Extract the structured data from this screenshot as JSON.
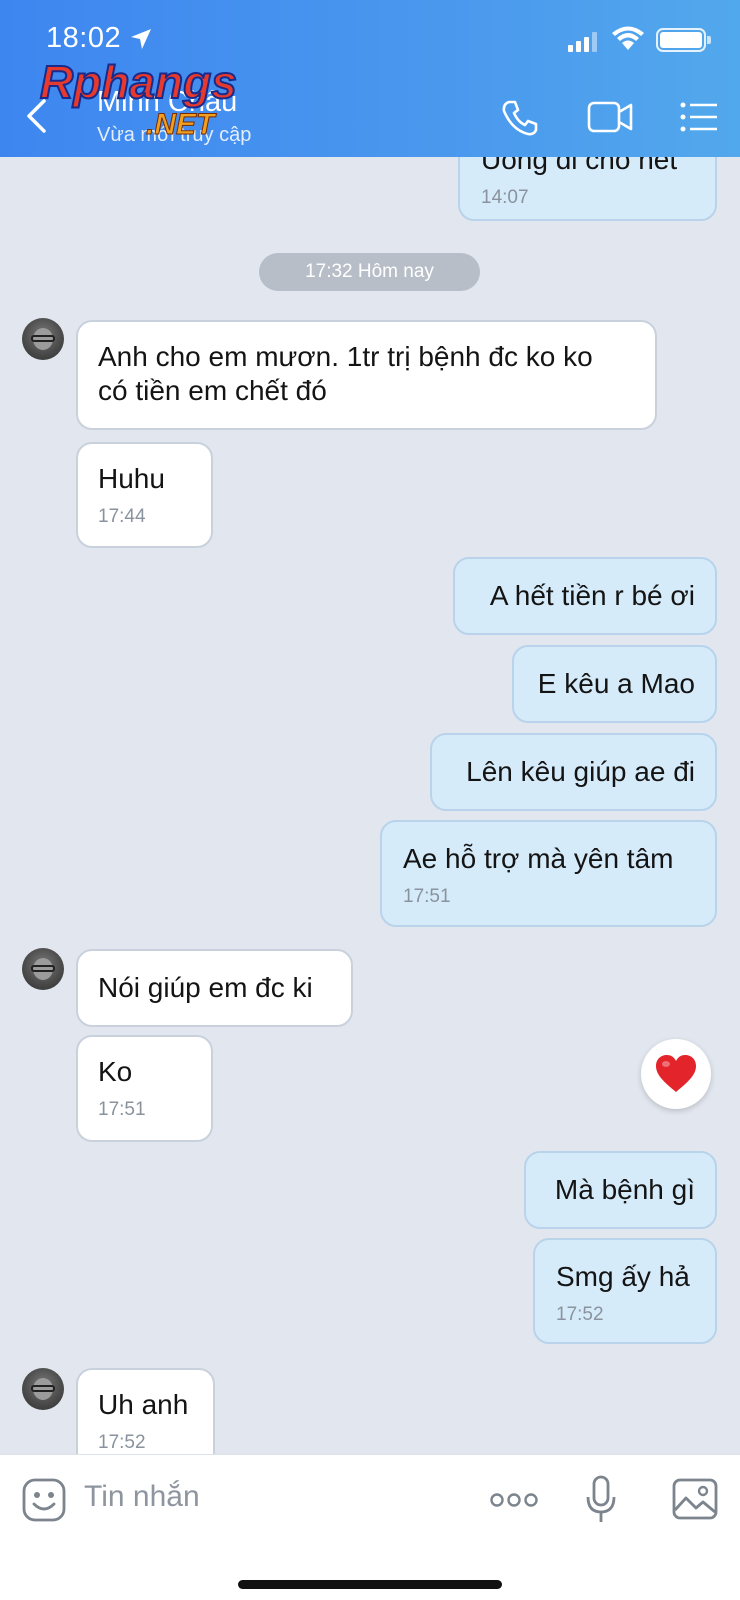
{
  "status": {
    "time": "18:02"
  },
  "header": {
    "contact_name": "Minh Châu",
    "contact_status": "Vừa mới truy cập",
    "watermark_text": "Rphangs.NET"
  },
  "messages": {
    "prev": {
      "text": "Uống đi cho hết",
      "time": "14:07"
    },
    "divider": "17:32 Hôm nay",
    "m1": {
      "text": "Anh cho em mươn. 1tr trị bệnh đc ko ko\ncó tiền em chết đó"
    },
    "m2": {
      "text": "Huhu",
      "time": "17:44"
    },
    "m3": {
      "text": "A hết tiền r bé ơi"
    },
    "m4": {
      "text": "E kêu a Mao"
    },
    "m5": {
      "text": "Lên kêu giúp ae đi"
    },
    "m6": {
      "text": "Ae hỗ trợ mà yên tâm",
      "time": "17:51"
    },
    "m7": {
      "text": "Nói giúp em đc ki"
    },
    "m8": {
      "text": "Ko",
      "time": "17:51"
    },
    "m9": {
      "text": "Mà bệnh gì"
    },
    "m10": {
      "text": "Smg ấy hả",
      "time": "17:52"
    },
    "m11": {
      "text": "Uh anh",
      "time": "17:52"
    }
  },
  "input": {
    "placeholder": "Tin nhắn"
  },
  "icons": {
    "back": "chevron-left-icon",
    "call": "phone-icon",
    "video": "video-camera-icon",
    "menu": "list-menu-icon",
    "sticker": "smiley-icon",
    "more": "more-dots-icon",
    "mic": "microphone-icon",
    "image": "image-icon",
    "reaction": "heart-icon"
  },
  "colors": {
    "header": "#4a90ee",
    "outgoing_bubble": "#d5ebfa",
    "incoming_bubble": "#ffffff",
    "chat_bg": "#e2e7ef"
  }
}
